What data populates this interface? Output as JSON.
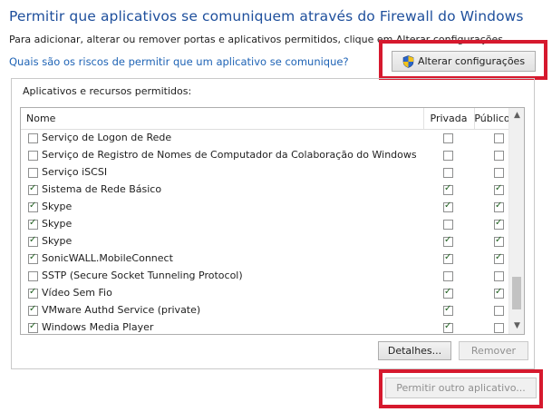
{
  "title": "Permitir que aplicativos se comuniquem através do Firewall do Windows",
  "subtitle": "Para adicionar, alterar ou remover portas e aplicativos permitidos, clique em Alterar configurações.",
  "risk_link": "Quais são os riscos de permitir que um aplicativo se comunique?",
  "change_settings_button": {
    "label": "Alterar configurações",
    "icon": "uac-shield-icon"
  },
  "group_label": "Aplicativos e recursos permitidos:",
  "columns": {
    "name": "Nome",
    "private": "Privada",
    "public": "Público"
  },
  "apps": [
    {
      "name": "Serviço de Logon de Rede",
      "enabled": false,
      "private": false,
      "public": false
    },
    {
      "name": "Serviço de Registro de Nomes de Computador da Colaboração do Windows",
      "enabled": false,
      "private": false,
      "public": false
    },
    {
      "name": "Serviço iSCSI",
      "enabled": false,
      "private": false,
      "public": false
    },
    {
      "name": "Sistema de Rede Básico",
      "enabled": true,
      "private": true,
      "public": true
    },
    {
      "name": "Skype",
      "enabled": true,
      "private": true,
      "public": true
    },
    {
      "name": "Skype",
      "enabled": true,
      "private": false,
      "public": true
    },
    {
      "name": "Skype",
      "enabled": true,
      "private": true,
      "public": true
    },
    {
      "name": "SonicWALL.MobileConnect",
      "enabled": true,
      "private": true,
      "public": true
    },
    {
      "name": "SSTP (Secure Socket Tunneling Protocol)",
      "enabled": false,
      "private": false,
      "public": false
    },
    {
      "name": "Vídeo Sem Fio",
      "enabled": true,
      "private": true,
      "public": true
    },
    {
      "name": "VMware Authd Service (private)",
      "enabled": true,
      "private": true,
      "public": false
    },
    {
      "name": "Windows Media Player",
      "enabled": true,
      "private": true,
      "public": false
    }
  ],
  "details_button": "Detalhes...",
  "remove_button": "Remover",
  "allow_other_button": "Permitir outro aplicativo...",
  "colors": {
    "title": "#1e4f9c",
    "link": "#1e63b5",
    "highlight": "#d6192e"
  }
}
